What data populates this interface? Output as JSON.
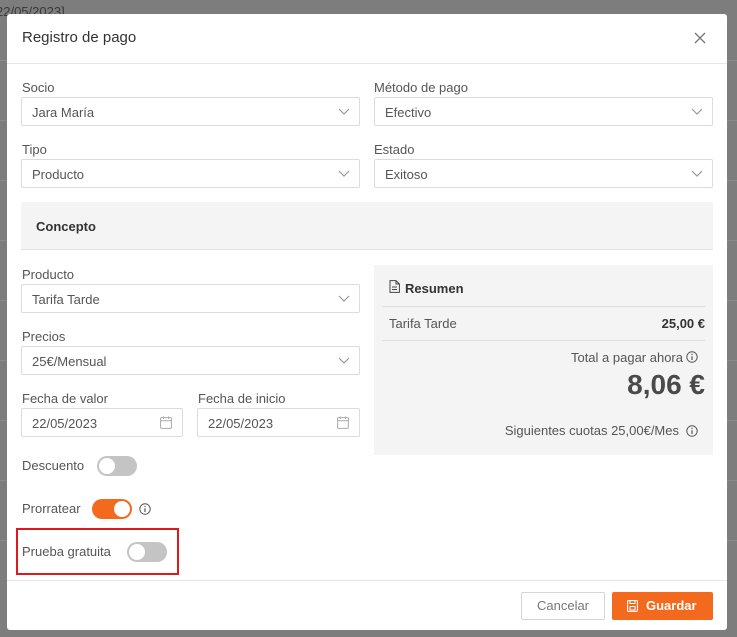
{
  "background": {
    "fragment": "22/05/2023]"
  },
  "modal": {
    "title": "Registro de pago",
    "fields": {
      "socio": {
        "label": "Socio",
        "value": "Jara María"
      },
      "metodo": {
        "label": "Método de pago",
        "value": "Efectivo"
      },
      "tipo": {
        "label": "Tipo",
        "value": "Producto"
      },
      "estado": {
        "label": "Estado",
        "value": "Exitoso"
      }
    },
    "concept": {
      "heading": "Concepto",
      "producto": {
        "label": "Producto",
        "value": "Tarifa Tarde"
      },
      "precios": {
        "label": "Precios",
        "value": "25€/Mensual"
      },
      "fecha_valor": {
        "label": "Fecha de valor",
        "value": "22/05/2023"
      },
      "fecha_inicio": {
        "label": "Fecha de inicio",
        "value": "22/05/2023"
      }
    },
    "toggles": {
      "descuento": {
        "label": "Descuento",
        "on": false
      },
      "prorratear": {
        "label": "Prorratear",
        "on": true
      },
      "prueba": {
        "label": "Prueba gratuita",
        "on": false
      }
    },
    "summary": {
      "title": "Resumen",
      "item_name": "Tarifa Tarde",
      "item_price": "25,00 €",
      "total_label": "Total a pagar ahora",
      "total_amount": "8,06 €",
      "next_fees": "Siguientes cuotas 25,00€/Mes"
    },
    "footer": {
      "cancel_label": "Cancelar",
      "save_label": "Guardar"
    }
  },
  "colors": {
    "accent": "#f36a1e",
    "highlight": "#e01a1a"
  },
  "icons": [
    "close-icon",
    "chevron-down-icon",
    "calendar-icon",
    "document-icon",
    "info-icon",
    "save-icon"
  ]
}
